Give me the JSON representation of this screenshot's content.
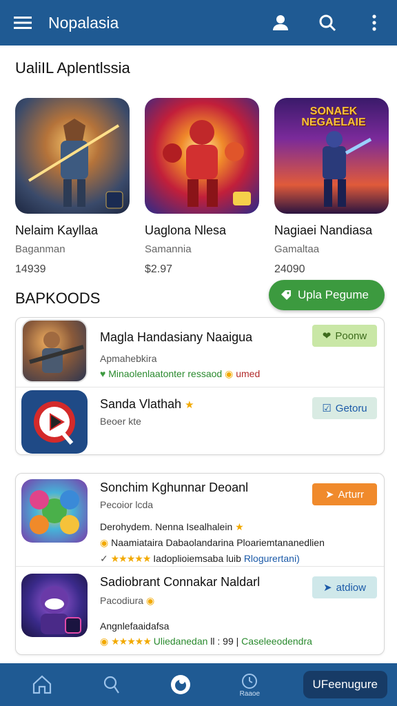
{
  "app": {
    "title": "Nopalasia"
  },
  "featured": {
    "heading": "UaliIL Aplentlssia",
    "items": [
      {
        "name": "Nelaim Kayllaa",
        "category": "Baganman",
        "price": "14939",
        "badge": ""
      },
      {
        "name": "Uaglona Nlesa",
        "category": "Samannia",
        "price": "$2.97",
        "badge": ""
      },
      {
        "name": "Nagiaei Nandiasa",
        "category": "Gamaltaa",
        "price": "24090",
        "badge": "SONAEK NEGAELAIE"
      }
    ]
  },
  "fab": {
    "label": "Upla Pegume"
  },
  "section2": {
    "heading": "BAPKOODS"
  },
  "list_a": [
    {
      "title": "Magla Handasiany Naaigua",
      "subtitle": "Apmahebkira",
      "line": "Minaolenlaatonter ressaod",
      "line_suffix": "umed",
      "action": "Poonw",
      "action_color": "#c9e7a6",
      "action_text_color": "#3d6b1c"
    },
    {
      "title": "Sanda Vlathah",
      "subtitle": "Beoer kte",
      "line": "",
      "action": "Getoru",
      "action_color": "#d9ebe3",
      "action_text_color": "#1b5aa8"
    }
  ],
  "list_b": [
    {
      "title": "Sonchim Kghunnar Deoanl",
      "subtitle": "Pecoior lcda",
      "line1": "Derohydem. Nenna Isealhalein",
      "line2": "Naamiataira Dabaolandarina Ploariemtananedlien",
      "stars_line": "★★★★★",
      "line3": "Iadoplioiemsaba luib",
      "line3_link": "Rlogurertani)",
      "action": "Arturr",
      "action_color": "#f08a2c",
      "action_text_color": "#ffffff"
    },
    {
      "title": "Sadiobrant Connakar Naldarl",
      "subtitle": "Pacodiura",
      "line1": "Angnlefaaidafsa",
      "stars_line": "★★★★★",
      "line2": "Uliedanedan",
      "line2_mid": "ll : 99 |",
      "line2_end": "Caseleeodendra",
      "action": "atdiow",
      "action_color": "#cfe8ea",
      "action_text_color": "#1b5aa8"
    }
  ],
  "bottom_nav": {
    "cta": "UFeenugure",
    "label_4": "Raaoe"
  },
  "colors": {
    "primary": "#1f5a93",
    "accent_green": "#3c9a3f"
  }
}
